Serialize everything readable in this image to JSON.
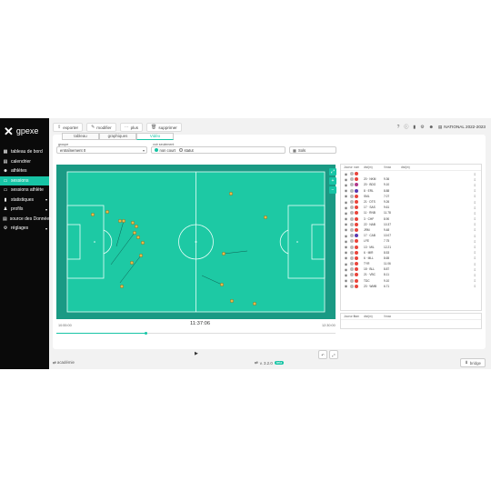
{
  "brand": {
    "name": "gpexe",
    "logo_glyph": "✕"
  },
  "sidebar": {
    "items": [
      {
        "label": "tableau de bord",
        "icon": "dashboard-icon",
        "glyph": "▦",
        "chevron": ""
      },
      {
        "label": "calendrier",
        "icon": "calendar-icon",
        "glyph": "▤",
        "chevron": ""
      },
      {
        "label": "athlètes",
        "icon": "athletes-icon",
        "glyph": "☻",
        "chevron": ""
      },
      {
        "label": "sessions",
        "icon": "sessions-icon",
        "glyph": "▭",
        "chevron": "",
        "active": true
      },
      {
        "label": "sessions athlète",
        "icon": "athlete-sessions-icon",
        "glyph": "▭",
        "chevron": ""
      },
      {
        "label": "statistiques",
        "icon": "stats-icon",
        "glyph": "▮",
        "chevron": "▾"
      },
      {
        "label": "profils",
        "icon": "profiles-icon",
        "glyph": "♟",
        "chevron": "▾"
      },
      {
        "label": "source des Données",
        "icon": "database-icon",
        "glyph": "▤",
        "chevron": ""
      },
      {
        "label": "réglages",
        "icon": "settings-icon",
        "glyph": "⚙",
        "chevron": "▾"
      }
    ]
  },
  "toolbar": {
    "buttons": [
      {
        "label": "exporter",
        "icon": "export-icon",
        "glyph": "⇪"
      },
      {
        "label": "modifier",
        "icon": "edit-icon",
        "glyph": "✎"
      },
      {
        "label": "plus",
        "icon": "more-icon",
        "glyph": "⋯"
      },
      {
        "label": "supprimer",
        "icon": "delete-icon",
        "glyph": "🗑"
      }
    ],
    "season": "NATIONAL 2022-2023",
    "right_icons": [
      "help-icon",
      "info-icon",
      "chart-icon",
      "gear-icon",
      "user-icon"
    ]
  },
  "tabs": [
    "tableau",
    "graphiques",
    "Vidéo"
  ],
  "filters": {
    "group_label": "groupe",
    "group_value": "entraînement 0",
    "mode_label": "voir seulement",
    "mode_options": [
      "non court",
      "statut"
    ],
    "third_value": "Sols"
  },
  "timeline": {
    "start": "10:55:00",
    "current": "11:37:06",
    "end": "12:30:00",
    "progress": 0.32
  },
  "list": {
    "headers": [
      "Joueur",
      "nom",
      "dist(m)",
      "Vmax",
      "dist(m)"
    ],
    "rows": [
      {
        "name": "",
        "val": "",
        "color": "#e8453c"
      },
      {
        "name": "20 · NKM",
        "val": "9.36",
        "color": "#e8453c"
      },
      {
        "name": "20 · BDO",
        "val": "9.10",
        "color": "#b03a8c"
      },
      {
        "name": "8 · ERL",
        "val": "8.88",
        "color": "#5a3ab0"
      },
      {
        "name": "SML",
        "val": "7.07",
        "color": "#e8453c"
      },
      {
        "name": "21 · DTS",
        "val": "9.26",
        "color": "#e8453c"
      },
      {
        "name": "17 · SAS",
        "val": "9.61",
        "color": "#e8453c"
      },
      {
        "name": "11 · RNB",
        "val": "11.78",
        "color": "#e8453c"
      },
      {
        "name": "3 · CHF",
        "val": "8.90",
        "color": "#e8453c"
      },
      {
        "name": "22 · NAB",
        "val": "10.37",
        "color": "#e8453c"
      },
      {
        "name": "JRM",
        "val": "9.48",
        "color": "#e8453c"
      },
      {
        "name": "17 · CAB",
        "val": "10.07",
        "color": "#5a3ab0"
      },
      {
        "name": "LFE",
        "val": "7.75",
        "color": "#e8453c"
      },
      {
        "name": "13 · MIL",
        "val": "12.21",
        "color": "#e8453c"
      },
      {
        "name": "6 · MIR",
        "val": "8.53",
        "color": "#e8453c"
      },
      {
        "name": "6 · MLL",
        "val": "8.65",
        "color": "#e8453c"
      },
      {
        "name": "TYR",
        "val": "11.06",
        "color": "#e8453c"
      },
      {
        "name": "18 · BLL",
        "val": "8.87",
        "color": "#e8453c"
      },
      {
        "name": "21 · VBC",
        "val": "8.11",
        "color": "#e8453c"
      },
      {
        "name": "TDC",
        "val": "9.10",
        "color": "#e8453c"
      },
      {
        "name": "23 · WMB",
        "val": "6.71",
        "color": "#e8453c"
      }
    ],
    "second_headers": [
      "Joueur B",
      "nom",
      "dist(m)",
      "Vmax"
    ]
  },
  "footer": {
    "academy": "académie",
    "version": "v. 3.2.0",
    "version_badge": "beta",
    "bridge": "bridge"
  },
  "colors": {
    "accent": "#17c4a5",
    "pitch": "#1dc9a4",
    "pitch_border": "#34a58f",
    "player": "#e6b84a"
  }
}
